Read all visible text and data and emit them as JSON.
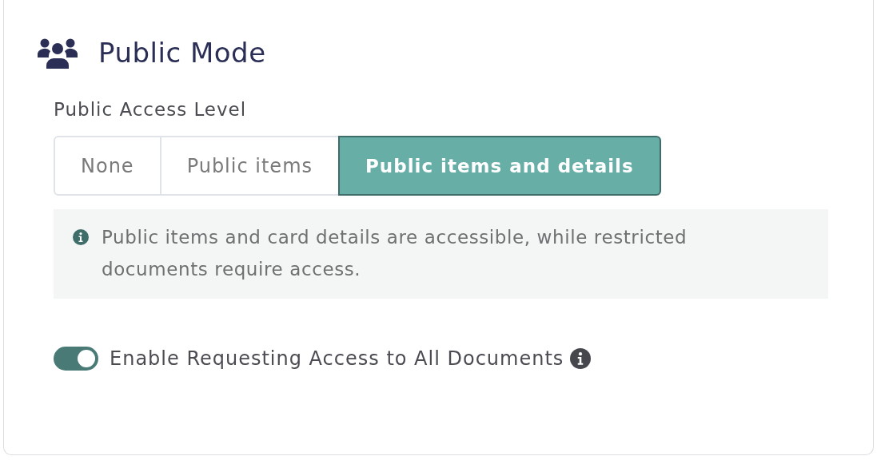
{
  "title": "Public Mode",
  "access_level": {
    "label": "Public Access Level",
    "options": [
      {
        "label": "None",
        "selected": false
      },
      {
        "label": "Public items",
        "selected": false
      },
      {
        "label": "Public items and details",
        "selected": true
      }
    ]
  },
  "info": "Public items and card details are accessible, while restricted documents require access.",
  "toggle": {
    "label": "Enable Requesting Access to All Documents",
    "on": true
  }
}
